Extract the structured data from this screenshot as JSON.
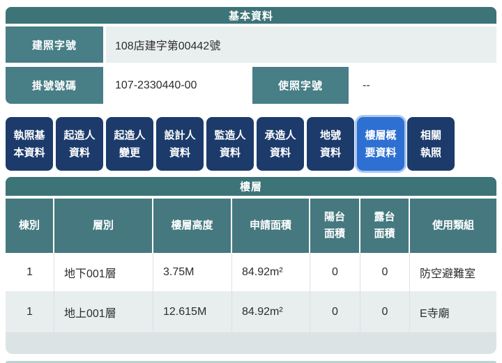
{
  "basic_info": {
    "title": "基本資料",
    "permit_no_label": "建照字號",
    "permit_no_value": "108店建字第00442號",
    "registration_no_label": "掛號號碼",
    "registration_no_value": "107-2330440-00",
    "usage_permit_label": "使照字號",
    "usage_permit_value": "--"
  },
  "tabs": [
    {
      "label": "執照基本資料",
      "lines": [
        "執照基",
        "本資料"
      ],
      "active": false
    },
    {
      "label": "起造人資料",
      "lines": [
        "起造人",
        "資料"
      ],
      "active": false
    },
    {
      "label": "起造人變更",
      "lines": [
        "起造人",
        "變更"
      ],
      "active": false
    },
    {
      "label": "設計人資料",
      "lines": [
        "設計人",
        "資料"
      ],
      "active": false
    },
    {
      "label": "監造人資料",
      "lines": [
        "監造人",
        "資料"
      ],
      "active": false
    },
    {
      "label": "承造人資料",
      "lines": [
        "承造人",
        "資料"
      ],
      "active": false
    },
    {
      "label": "地號資料",
      "lines": [
        "地號",
        "資料"
      ],
      "active": false
    },
    {
      "label": "樓層概要資料",
      "lines": [
        "樓層概",
        "要資料"
      ],
      "active": true
    },
    {
      "label": "相關執照",
      "lines": [
        "相關",
        "執照"
      ],
      "active": false
    }
  ],
  "floor_table": {
    "title": "樓層",
    "columns": [
      {
        "label": "棟別",
        "lines": [
          "棟別"
        ]
      },
      {
        "label": "層別",
        "lines": [
          "層別"
        ]
      },
      {
        "label": "樓層高度",
        "lines": [
          "樓層高度"
        ]
      },
      {
        "label": "申請面積",
        "lines": [
          "申請面積"
        ]
      },
      {
        "label": "陽台面積",
        "lines": [
          "陽台",
          "面積"
        ]
      },
      {
        "label": "露台面積",
        "lines": [
          "露台",
          "面積"
        ]
      },
      {
        "label": "使用類組",
        "lines": [
          "使用類組"
        ]
      }
    ],
    "rows": [
      {
        "building": "1",
        "floor": "地下001層",
        "height": "3.75M",
        "area": "84.92m²",
        "balcony": "0",
        "terrace": "0",
        "usage": "防空避難室"
      },
      {
        "building": "1",
        "floor": "地上001層",
        "height": "12.615M",
        "area": "84.92m²",
        "balcony": "0",
        "terrace": "0",
        "usage": "E寺廟"
      }
    ]
  },
  "colors": {
    "teal_header": "#3d7478",
    "teal_label": "#487e86",
    "teal_thead": "#45797f",
    "navy_tab": "#1c3b6b",
    "active_tab_bg": "#2e70d2",
    "active_tab_halo": "#a9c8f0",
    "light_value_row": "#e9efee",
    "alt_table_row": "#e8edee",
    "table_footer": "#dce3e5"
  }
}
